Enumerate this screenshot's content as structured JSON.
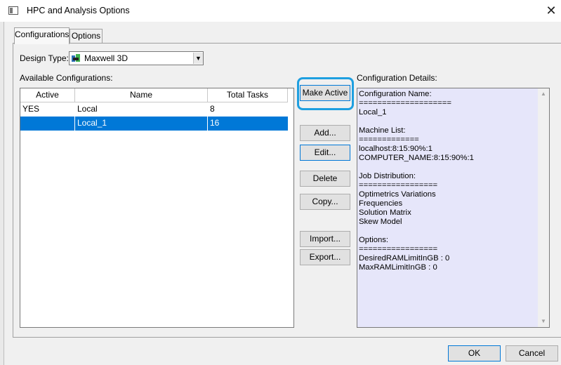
{
  "window": {
    "title": "HPC and Analysis Options",
    "close": "✕"
  },
  "tabs": [
    {
      "label": "Configurations"
    },
    {
      "label": "Options"
    }
  ],
  "design_type": {
    "label": "Design Type:",
    "value": "Maxwell 3D"
  },
  "available_label": "Available Configurations:",
  "details_label": "Configuration Details:",
  "table": {
    "headers": [
      "Active",
      "Name",
      "Total Tasks"
    ],
    "rows": [
      {
        "active": "YES",
        "name": "Local",
        "tasks": "8",
        "selected": false
      },
      {
        "active": "",
        "name": "Local_1",
        "tasks": "16",
        "selected": true
      }
    ]
  },
  "buttons": {
    "make_active": "Make Active",
    "add": "Add...",
    "edit": "Edit...",
    "delete": "Delete",
    "copy": "Copy...",
    "import": "Import...",
    "export": "Export..."
  },
  "details_text": "Configuration Name:\n====================\nLocal_1\n\nMachine List:\n=============\nlocalhost:8:15:90%:1\nCOMPUTER_NAME:8:15:90%:1\n\nJob Distribution:\n=================\nOptimetrics Variations\nFrequencies\nSolution Matrix\nSkew Model\n\nOptions:\n=================\nDesiredRAMLimitInGB : 0\nMaxRAMLimitInGB : 0",
  "footer": {
    "ok": "OK",
    "cancel": "Cancel"
  },
  "colors": {
    "selection": "#0078d7",
    "details_bg": "#e6e6fa",
    "highlight_ring": "#1e9fe0"
  }
}
